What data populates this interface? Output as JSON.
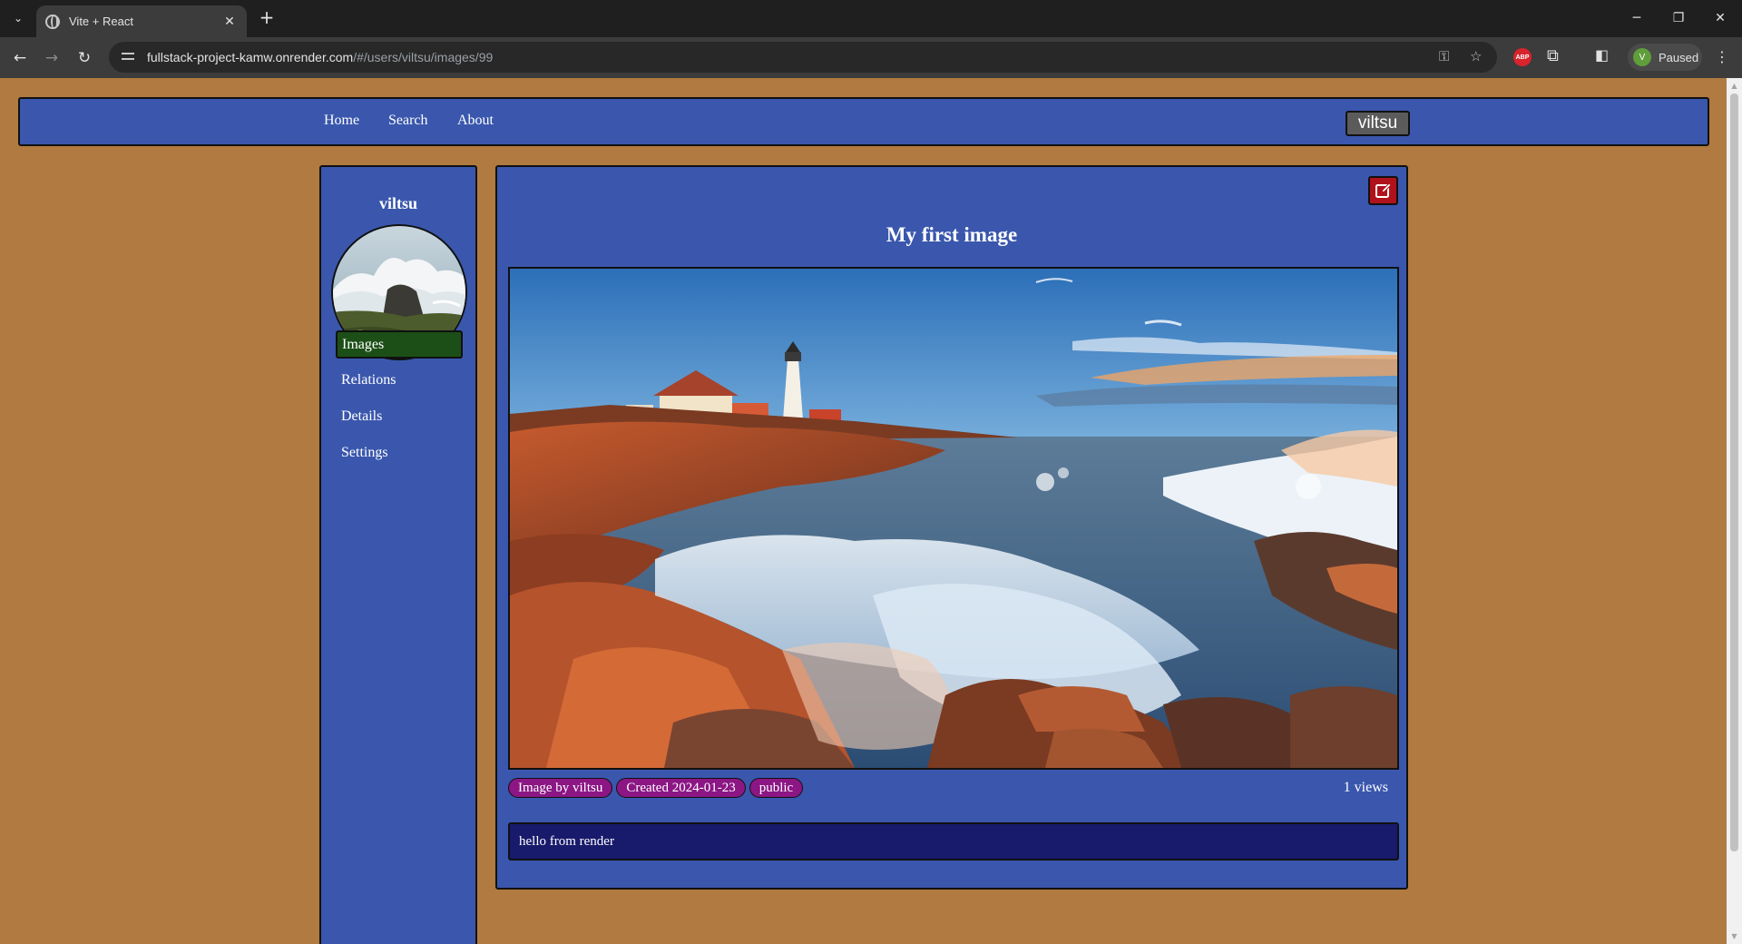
{
  "browser": {
    "tab_title": "Vite + React",
    "url_host": "fullstack-project-kamw.onrender.com",
    "url_path": "/#/users/viltsu/images/99",
    "profile_initial": "V",
    "profile_status": "Paused",
    "abp_label": "ABP"
  },
  "nav": {
    "links": [
      "Home",
      "Search",
      "About"
    ],
    "current_user": "viltsu"
  },
  "sidebar": {
    "username": "viltsu",
    "items": [
      {
        "label": "Images",
        "active": true
      },
      {
        "label": "Relations",
        "active": false
      },
      {
        "label": "Details",
        "active": false
      },
      {
        "label": "Settings",
        "active": false
      }
    ]
  },
  "image_view": {
    "title": "My first image",
    "tags": [
      "Image by viltsu",
      "Created 2024-01-23",
      "public"
    ],
    "views": "1 views",
    "description": "hello from render"
  },
  "colors": {
    "page_bg": "#b07a40",
    "panel_blue": "#3a57ad",
    "active_green": "#1c4f17",
    "tag_purple": "#8b1684",
    "edit_red": "#b0121b",
    "description_navy": "#181a6c"
  },
  "icons": {
    "edit": "pencil-square-icon",
    "avatar_photo": "ocean-waves-photo",
    "main_photo": "lighthouse-coast-photo"
  }
}
